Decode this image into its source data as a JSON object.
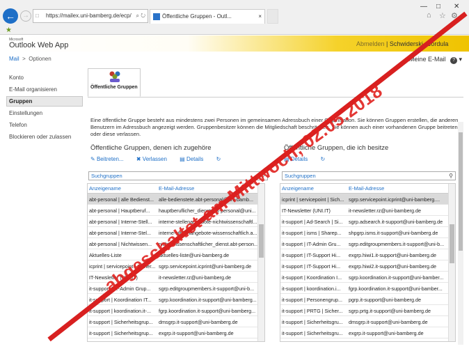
{
  "browser": {
    "url": "https://mailex.uni-bamberg.de/ecp/",
    "tab_title": "Öffentliche Gruppen - Outl...",
    "icons": {
      "back": "back-arrow-icon",
      "forward": "forward-arrow-icon",
      "home": "home-icon",
      "favorites": "star-icon",
      "settings": "gear-icon"
    }
  },
  "owa": {
    "brand_small": "Microsoft",
    "brand": "Outlook Web App",
    "user_dim": "Abmelden",
    "user_name": "Schwiderski, Cordula",
    "accent_color": "#efc300"
  },
  "breadcrumb": {
    "mail": "Mail",
    "options": "Optionen"
  },
  "my_email": "Meine E-Mail",
  "nav": [
    "Konto",
    "E-Mail organisieren",
    "Gruppen",
    "Einstellungen",
    "Telefon",
    "Blockieren oder zulassen"
  ],
  "nav_active": "Gruppen",
  "tab_label": "Öffentliche Gruppen",
  "description": "Eine öffentliche Gruppe besteht aus mindestens zwei Personen im gemeinsamen Adressbuch einer Organisation. Sie können Gruppen erstellen, die anderen Benutzern im Adressbuch angezeigt werden. Gruppenbesitzer können die Mitgliedschaft beschränken. Sie können auch einer vorhandenen Gruppe beitreten oder diese verlassen.",
  "left": {
    "title": "Öffentliche Gruppen, denen ich zugehöre",
    "join": "Beitreten...",
    "leave": "Verlassen",
    "details": "Details",
    "search_placeholder": "Suchgruppen",
    "col_name": "Anzeigename",
    "col_email": "E-Mail-Adresse",
    "rows": [
      [
        "abt-personal | alle Bedienst...",
        "alle-bedienstete.abt-personal@uni-bamb..."
      ],
      [
        "abt-personal | Hauptberuf...",
        "hauptberuflicher_dienst.abt-personal@uni..."
      ],
      [
        "abt-personal | Interne-Stell...",
        "interne-stellenangebote-nichtwissenschaftl..."
      ],
      [
        "abt-personal | Interne-Stel...",
        "interne-stellenangebote-wissenschaftlich.a..."
      ],
      [
        "abt-personal | Nichtwissen...",
        "nicht_wissenschaftlicher_dienst.abt-person..."
      ],
      [
        "Aktuelles-Liste",
        "aktuelles-liste@uni-bamberg.de"
      ],
      [
        "icprint | servicepoint | Sicher...",
        "sgrp.servicepoint.icprint@uni-bamberg.de"
      ],
      [
        "IT-Newsletter (UNI.IT)",
        "it-newsletter.rz@uni-bamberg.de"
      ],
      [
        "it-support | IT-Admin Grup...",
        "sgrp.editgroupmembers.it-support@uni-b..."
      ],
      [
        "it-support | Koordination IT...",
        "sgrp.koordination.it-support@uni-bamberg..."
      ],
      [
        "it-support | koordination.it-...",
        "fgrp.koordination.it-support@uni-bamberg..."
      ],
      [
        "it-support | Sicherheitsgrup...",
        "dmsgrp.it-support@uni-bamberg.de"
      ],
      [
        "it-support | Sicherheitsgrup...",
        "exgrp.it-support@uni-bamberg.de"
      ]
    ]
  },
  "right": {
    "title": "Öffentliche Gruppen, die ich besitze",
    "details": "Details",
    "search_placeholder": "Suchgruppen",
    "col_name": "Anzeigename",
    "col_email": "E-Mail-Adresse",
    "rows": [
      [
        "icprint | servicepoint | Sich...",
        "sgrp.servicepoint.icprint@uni-bamberg...."
      ],
      [
        "IT-Newsletter (UNI.IT)",
        "it-newsletter.rz@uni-bamberg.de"
      ],
      [
        "it-support | Ad-Search | Si...",
        "sgrp.adsearch.it-support@uni-bamberg.de"
      ],
      [
        "it-support | isms | Sharep...",
        "shpgrp.isms.it-support@uni-bamberg.de"
      ],
      [
        "it-support | IT-Admin Gru...",
        "sgrp.editgroupmembers.it-support@uni-b..."
      ],
      [
        "it-support | IT-Support Hi...",
        "exgrp.hiwi1.it-support@uni-bamberg.de"
      ],
      [
        "it-support | IT-Support Hi...",
        "exgrp.hiwi2.it-support@uni-bamberg.de"
      ],
      [
        "it-support | Koordination I...",
        "sgrp.koordination.it-support@uni-bamber..."
      ],
      [
        "it-support | koordination.i...",
        "fgrp.koordination.it-support@uni-bamber..."
      ],
      [
        "it-support | Personengrup...",
        "pgrp.it-support@uni-bamberg.de"
      ],
      [
        "it-support | PRTG | Sicher...",
        "sgrp.prtg.it-support@uni-bamberg.de"
      ],
      [
        "it-support | Sicherheitsgru...",
        "dmsgrp.it-support@uni-bamberg.de"
      ],
      [
        "it-support | Sicherheitsgru...",
        "exgrp.it-support@uni-bamberg.de"
      ]
    ]
  },
  "stamp_text": "abgeschaltet am Mittwoch, 02.05.2018",
  "stamp_color": "#e0221f"
}
